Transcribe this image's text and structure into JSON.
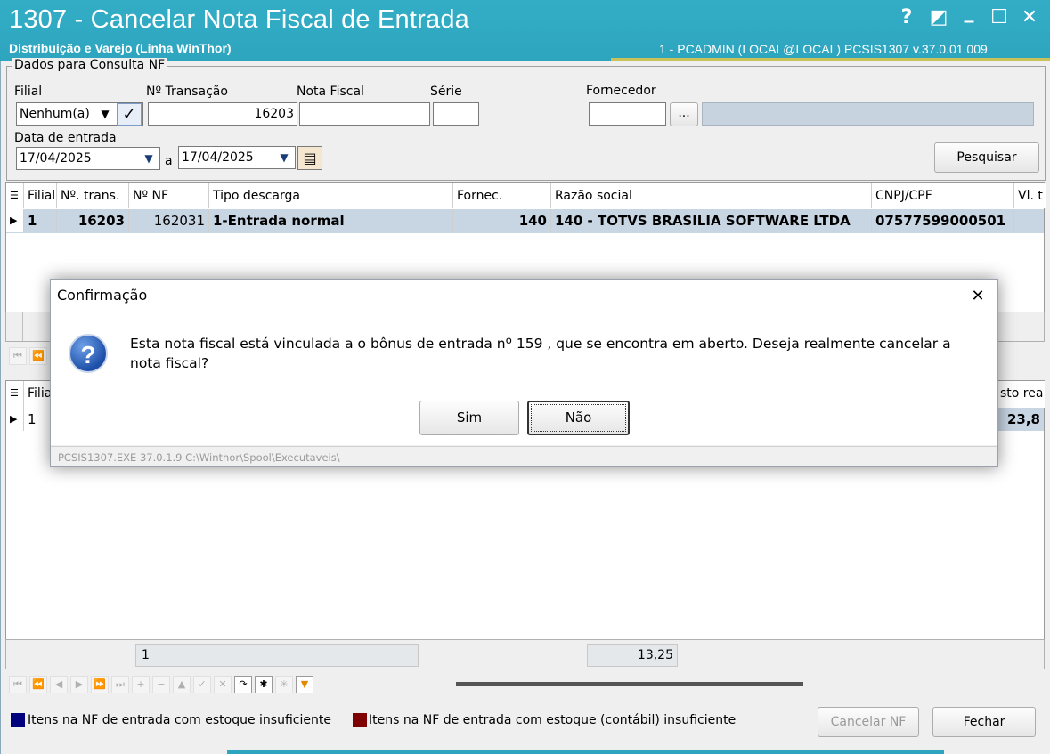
{
  "window": {
    "title": "1307 - Cancelar Nota Fiscal de Entrada",
    "subtitle": "Distribuição e Varejo (Linha WinThor)",
    "session_info": "1 - PCADMIN (LOCAL@LOCAL)   PCSIS1307  v.37.0.01.009",
    "help_glyph": "?",
    "restore_glyph": "◩",
    "minimize_glyph": "_",
    "maximize_glyph": "☐",
    "close_glyph": "✕"
  },
  "filter": {
    "group_label": "Dados para Consulta NF",
    "filial_label": "Filial",
    "filial_value": "Nenhum(a)",
    "transacao_label": "Nº Transação",
    "transacao_value": "16203",
    "nota_label": "Nota Fiscal",
    "nota_value": "",
    "serie_label": "Série",
    "serie_value": "",
    "fornecedor_label": "Fornecedor",
    "fornecedor_value": "",
    "ellipsis_label": "...",
    "data_label": "Data de entrada",
    "data_inicio": "17/04/2025",
    "data_sep": "a",
    "data_fim": "17/04/2025",
    "search_label": "Pesquisar"
  },
  "grid1": {
    "headers": [
      "Filial",
      "Nº. trans.",
      "Nº NF",
      "Tipo descarga",
      "Fornec.",
      "Razão social",
      "CNPJ/CPF",
      "Vl. t"
    ],
    "rows": [
      [
        "1",
        "16203",
        "162031",
        "1-Entrada normal",
        "140",
        "140 - TOTVS BRASILIA SOFTWARE LTDA",
        "07577599000501",
        ""
      ]
    ]
  },
  "grid2": {
    "headers": [
      "Filia",
      "sto rea"
    ],
    "rows": [
      [
        "1",
        "23,8"
      ]
    ],
    "footer_count": "1",
    "footer_total": "13,25"
  },
  "legend": {
    "item1": "Itens na NF de entrada com estoque insuficiente",
    "item1_color": "#00007f",
    "item2": "Itens na NF de entrada com estoque (contábil) insuficiente",
    "item2_color": "#7f0000"
  },
  "actions": {
    "cancel_label": "Cancelar NF",
    "close_label": "Fechar"
  },
  "dialog": {
    "title": "Confirmação",
    "close_glyph": "✕",
    "message": "Esta nota fiscal está vinculada a o bônus de entrada nº 159 , que se encontra em aberto. Deseja realmente cancelar a nota fiscal?",
    "yes_label": "Sim",
    "no_label": "Não",
    "footer": "PCSIS1307.EXE 37.0.1.9 C:\\Winthor\\Spool\\Executaveis\\"
  },
  "colors": {
    "titlebar": "#2ea5bf",
    "selected_row": "#c8d5e3"
  }
}
